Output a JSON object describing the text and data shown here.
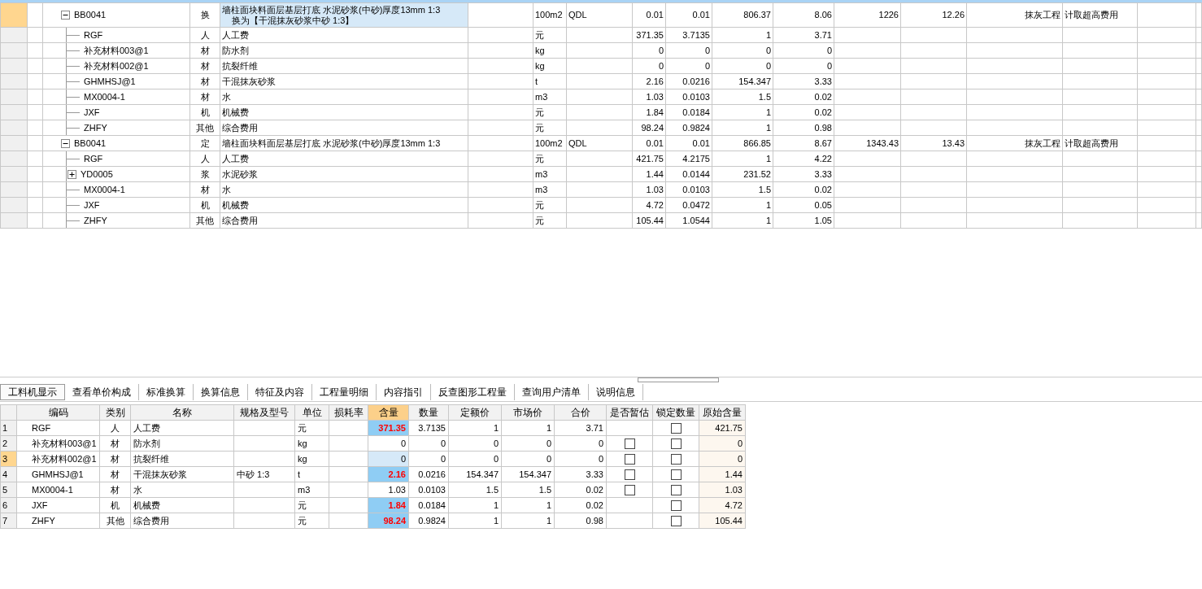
{
  "top_grid": {
    "rows": [
      {
        "code": "BB0041",
        "expanded": true,
        "category": "换",
        "name": "墙柱面块料面层基层打底 水泥砂浆(中砂)厚度13mm 1:3",
        "name_line2": "换为【干混抹灰砂浆中砂 1:3】",
        "unit": "100m2",
        "column_7": "QDL",
        "cells": [
          "0.01",
          "0.01",
          "806.37",
          "8.06",
          "1226",
          "12.26"
        ],
        "column_14": "抹灰工程",
        "column_15": "计取超高费用",
        "selected": true,
        "children": [
          {
            "code": "RGF",
            "category": "人",
            "name": "人工费",
            "unit": "元",
            "cells": [
              "371.35",
              "3.7135",
              "1",
              "3.71"
            ],
            "selected": false
          },
          {
            "code": "补充材料003@1",
            "category": "材",
            "name": "防水剂",
            "unit": "kg",
            "cells": [
              "0",
              "0",
              "0",
              "0"
            ],
            "selected": false
          },
          {
            "code": "补充材料002@1",
            "category": "材",
            "name": "抗裂纤维",
            "unit": "kg",
            "cells": [
              "0",
              "0",
              "0",
              "0"
            ],
            "selected": false
          },
          {
            "code": "GHMHSJ@1",
            "category": "材",
            "name": "干混抹灰砂浆",
            "unit": "t",
            "cells": [
              "2.16",
              "0.0216",
              "154.347",
              "3.33"
            ],
            "selected": false
          },
          {
            "code": "MX0004-1",
            "category": "材",
            "name": "水",
            "unit": "m3",
            "cells": [
              "1.03",
              "0.0103",
              "1.5",
              "0.02"
            ],
            "selected": false
          },
          {
            "code": "JXF",
            "category": "机",
            "name": "机械费",
            "unit": "元",
            "cells": [
              "1.84",
              "0.0184",
              "1",
              "0.02"
            ],
            "selected": false
          },
          {
            "code": "ZHFY",
            "category": "其他",
            "name": "综合费用",
            "unit": "元",
            "cells": [
              "98.24",
              "0.9824",
              "1",
              "0.98"
            ],
            "selected": false
          }
        ]
      },
      {
        "code": "BB0041",
        "expanded": true,
        "category": "定",
        "name": "墙柱面块料面层基层打底 水泥砂浆(中砂)厚度13mm 1:3",
        "unit": "100m2",
        "column_7": "QDL",
        "cells": [
          "0.01",
          "0.01",
          "866.85",
          "8.67",
          "1343.43",
          "13.43"
        ],
        "column_14": "抹灰工程",
        "column_15": "计取超高费用",
        "selected": false,
        "children": [
          {
            "code": "RGF",
            "category": "人",
            "name": "人工费",
            "unit": "元",
            "cells": [
              "421.75",
              "4.2175",
              "1",
              "4.22"
            ],
            "selected": false
          },
          {
            "code": "YD0005",
            "expanded": false,
            "category": "浆",
            "name": "水泥砂浆",
            "unit": "m3",
            "cells": [
              "1.44",
              "0.0144",
              "231.52",
              "3.33"
            ],
            "selected": false
          },
          {
            "code": "MX0004-1",
            "category": "材",
            "name": "水",
            "unit": "m3",
            "cells": [
              "1.03",
              "0.0103",
              "1.5",
              "0.02"
            ],
            "selected": false
          },
          {
            "code": "JXF",
            "category": "机",
            "name": "机械费",
            "unit": "元",
            "cells": [
              "4.72",
              "0.0472",
              "1",
              "0.05"
            ],
            "selected": false
          },
          {
            "code": "ZHFY",
            "category": "其他",
            "name": "综合费用",
            "unit": "元",
            "cells": [
              "105.44",
              "1.0544",
              "1",
              "1.05"
            ],
            "selected": false
          }
        ]
      }
    ]
  },
  "tabs": [
    {
      "label": "工料机显示",
      "selected": true
    },
    {
      "label": "查看单价构成",
      "selected": false
    },
    {
      "label": "标准换算",
      "selected": false
    },
    {
      "label": "换算信息",
      "selected": false
    },
    {
      "label": "特征及内容",
      "selected": false
    },
    {
      "label": "工程量明细",
      "selected": false
    },
    {
      "label": "内容指引",
      "selected": false
    },
    {
      "label": "反查图形工程量",
      "selected": false
    },
    {
      "label": "查询用户清单",
      "selected": false
    },
    {
      "label": "说明信息",
      "selected": false
    }
  ],
  "detail_grid": {
    "columns": [
      {
        "label": "编码",
        "selected": false
      },
      {
        "label": "类别",
        "selected": false
      },
      {
        "label": "名称",
        "selected": false
      },
      {
        "label": "规格及型号",
        "selected": false
      },
      {
        "label": "单位",
        "selected": false
      },
      {
        "label": "损耗率",
        "selected": false
      },
      {
        "label": "含量",
        "selected": true
      },
      {
        "label": "数量",
        "selected": false
      },
      {
        "label": "定额价",
        "selected": false
      },
      {
        "label": "市场价",
        "selected": false
      },
      {
        "label": "合价",
        "selected": false
      },
      {
        "label": "是否暂估",
        "selected": false
      },
      {
        "label": "锁定数量",
        "selected": false
      },
      {
        "label": "原始含量",
        "selected": false
      }
    ],
    "rows": [
      {
        "number": "1",
        "code": "RGF",
        "category": "人",
        "name": "人工费",
        "unit": "元",
        "amount": "371.35",
        "modified": true,
        "quantity": "3.7135",
        "quota_price": "1",
        "market_price": "1",
        "total": "3.71",
        "locked": false,
        "original_amount": "421.75",
        "selected": false
      },
      {
        "number": "2",
        "code": "补充材料003@1",
        "category": "材",
        "name": "防水剂",
        "unit": "kg",
        "amount": "0",
        "modified": false,
        "quantity": "0",
        "quota_price": "0",
        "market_price": "0",
        "total": "0",
        "provisional": false,
        "locked": false,
        "original_amount": "0",
        "selected": false
      },
      {
        "number": "3",
        "code": "补充材料002@1",
        "category": "材",
        "name": "抗裂纤维",
        "unit": "kg",
        "amount": "0",
        "modified": false,
        "quantity": "0",
        "quota_price": "0",
        "market_price": "0",
        "total": "0",
        "provisional": false,
        "locked": false,
        "original_amount": "0",
        "selected": true
      },
      {
        "number": "4",
        "code": "GHMHSJ@1",
        "category": "材",
        "name": "干混抹灰砂浆",
        "spec": "中砂 1:3",
        "unit": "t",
        "amount": "2.16",
        "modified": true,
        "quantity": "0.0216",
        "quota_price": "154.347",
        "market_price": "154.347",
        "total": "3.33",
        "provisional": false,
        "locked": false,
        "original_amount": "1.44",
        "selected": false
      },
      {
        "number": "5",
        "code": "MX0004-1",
        "category": "材",
        "name": "水",
        "unit": "m3",
        "amount": "1.03",
        "modified": false,
        "quantity": "0.0103",
        "quota_price": "1.5",
        "market_price": "1.5",
        "total": "0.02",
        "provisional": false,
        "locked": false,
        "original_amount": "1.03",
        "selected": false
      },
      {
        "number": "6",
        "code": "JXF",
        "category": "机",
        "name": "机械费",
        "unit": "元",
        "amount": "1.84",
        "modified": true,
        "quantity": "0.0184",
        "quota_price": "1",
        "market_price": "1",
        "total": "0.02",
        "locked": false,
        "original_amount": "4.72",
        "selected": false
      },
      {
        "number": "7",
        "code": "ZHFY",
        "category": "其他",
        "name": "综合费用",
        "unit": "元",
        "amount": "98.24",
        "modified": true,
        "quantity": "0.9824",
        "quota_price": "1",
        "market_price": "1",
        "total": "0.98",
        "locked": false,
        "original_amount": "105.44",
        "selected": false
      }
    ]
  }
}
